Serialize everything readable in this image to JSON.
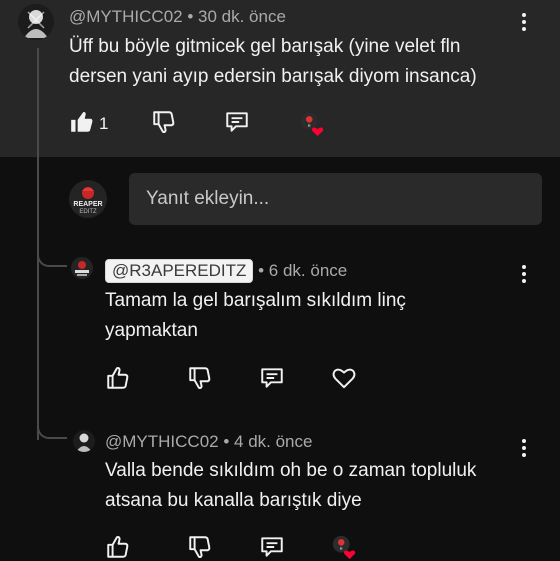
{
  "top_comment": {
    "handle": "@MYTHICC02",
    "time": "• 30 dk. önce",
    "text_line1": "Üff bu böyle gitmicek gel barışak (yine velet fln",
    "text_line2": "dersen yani ayıp edersin barışak diyom insanca)",
    "like_count": "1",
    "icons": [
      "thumbs-up-filled",
      "thumbs-down",
      "comment",
      "creator-heart"
    ]
  },
  "reply_input": {
    "placeholder": "Yanıt ekleyin..."
  },
  "replies": [
    {
      "handle": "@R3APEREDITZ",
      "time": "• 6 dk. önce",
      "text_line1": "Tamam la gel barışalım sıkıldım linç",
      "text_line2": "yapmaktan",
      "icons": [
        "thumbs-up",
        "thumbs-down",
        "comment",
        "heart"
      ]
    },
    {
      "handle": "@MYTHICC02",
      "time": "• 4 dk. önce",
      "text_line1": "Valla bende sıkıldım oh be o zaman topluluk",
      "text_line2": "atsana bu kanalla barıştık diye",
      "icons": [
        "thumbs-up",
        "thumbs-down",
        "comment",
        "creator-heart"
      ]
    }
  ],
  "colors": {
    "background": "#0f0f0f",
    "highlight_background": "#272727",
    "text": "#f1f1f1",
    "meta": "#aaaaaa",
    "heart": "#ff0033"
  }
}
